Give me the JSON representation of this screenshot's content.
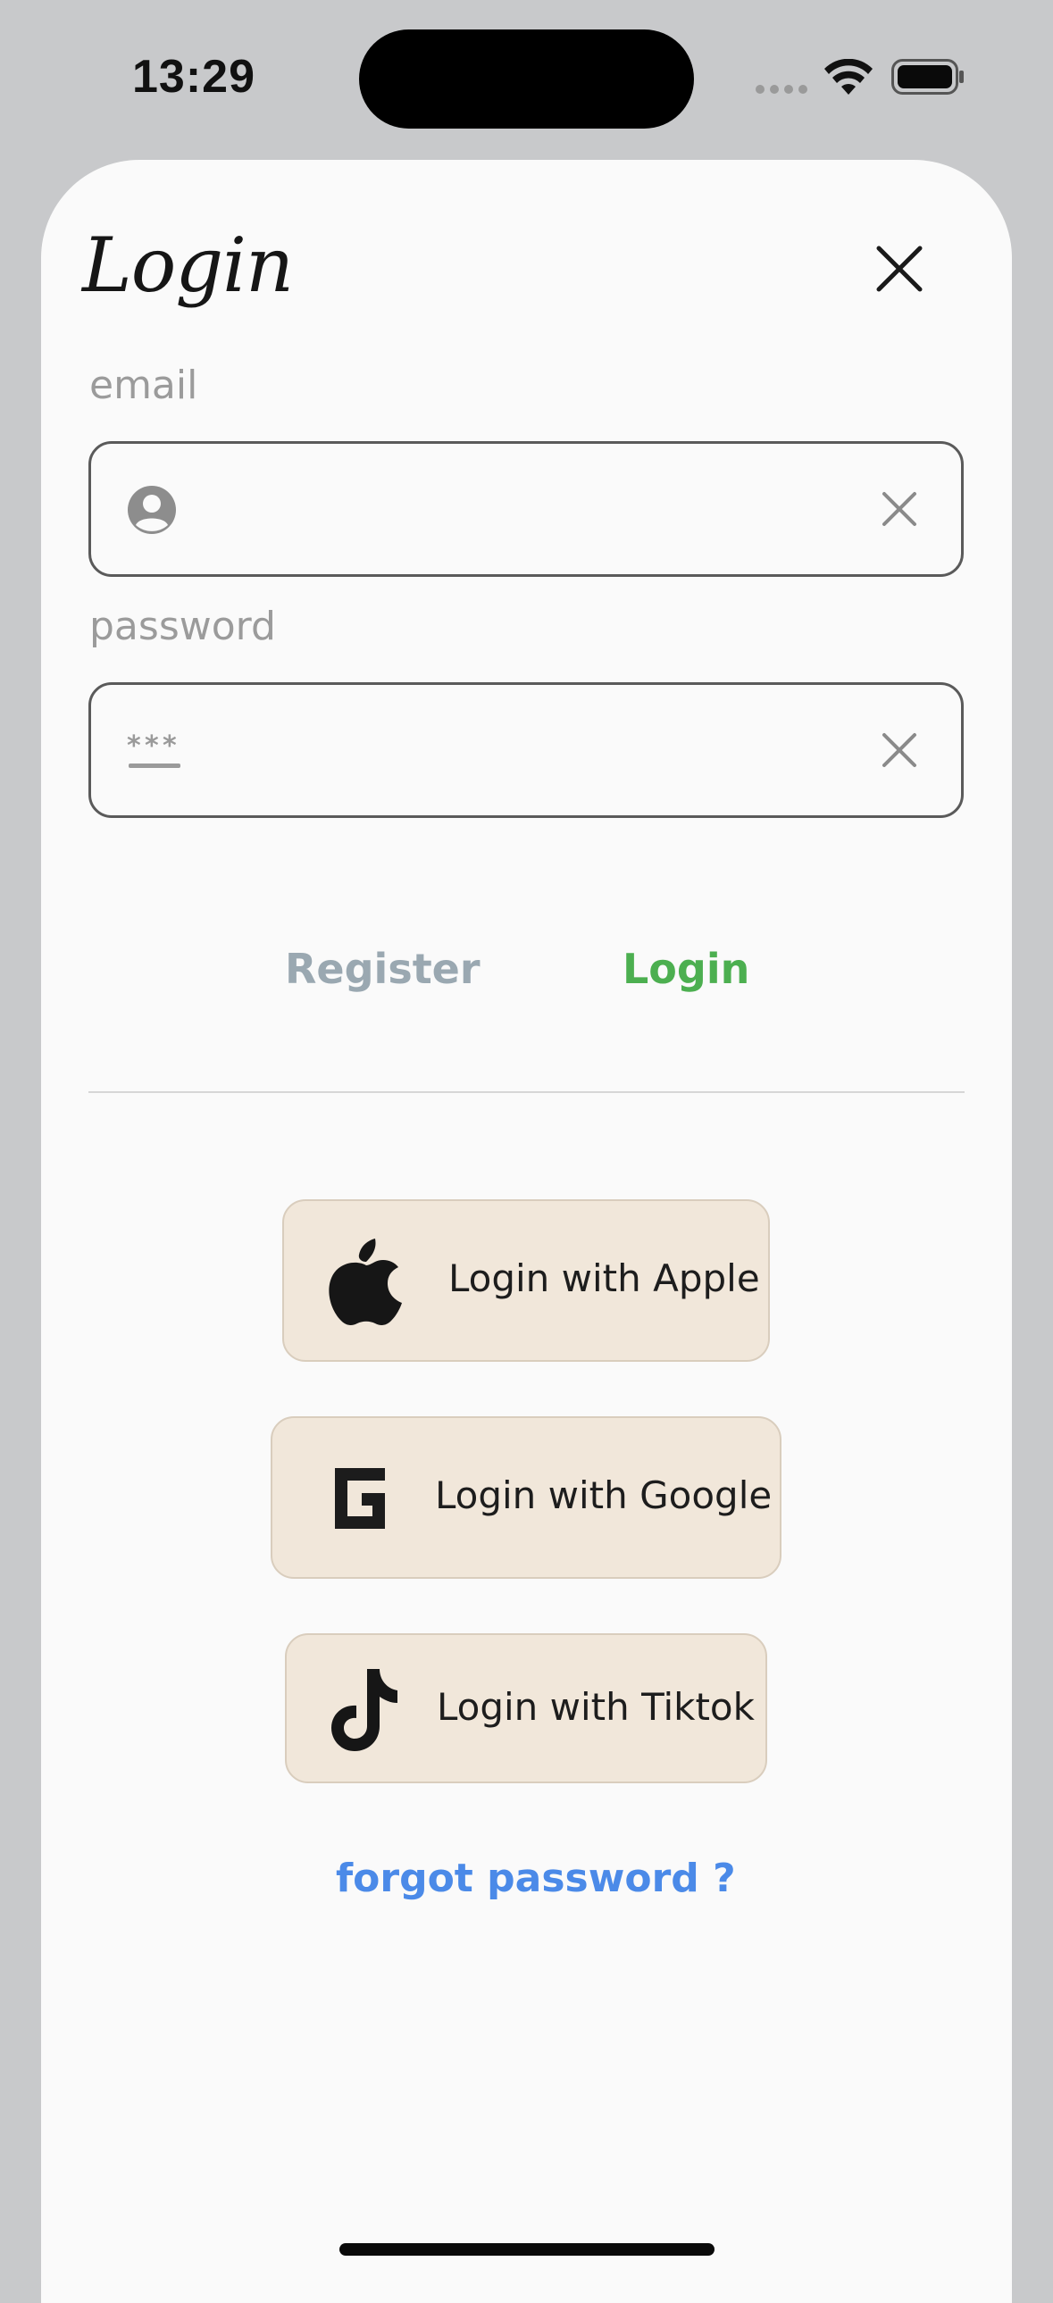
{
  "status_bar": {
    "time": "13:29",
    "icons": [
      "cellular-dots-icon",
      "wifi-icon",
      "battery-icon"
    ]
  },
  "sheet": {
    "title": "Login",
    "close_icon": "close-icon"
  },
  "form": {
    "email_label": "email",
    "email_value": "",
    "email_icon": "person-circle-icon",
    "password_label": "password",
    "password_value": "",
    "password_icon": "password-dots-icon",
    "clear_icon": "clear-x-icon"
  },
  "actions": {
    "register_label": "Register",
    "login_label": "Login"
  },
  "social": [
    {
      "label": "Login with Apple",
      "icon": "apple-icon"
    },
    {
      "label": "Login with Google",
      "icon": "google-icon"
    },
    {
      "label": "Login with Tiktok",
      "icon": "tiktok-icon"
    }
  ],
  "forgot_label": "forgot password ?",
  "colors": {
    "login_accent": "#4caf50",
    "register_muted": "#9aa8b1",
    "link_blue": "#4b8ae8",
    "social_button_bg": "#f1e7da",
    "backdrop": "#c8c9cb",
    "sheet_bg": "#fafafa"
  }
}
